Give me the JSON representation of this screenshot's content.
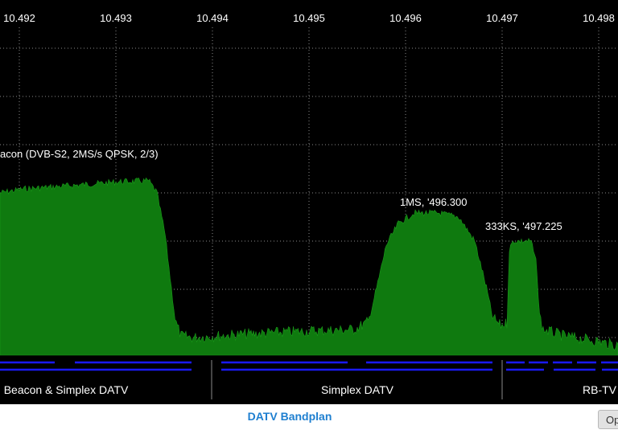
{
  "spectrum": {
    "frequency_ticks": [
      "10.492",
      "10.493",
      "10.494",
      "10.495",
      "10.496",
      "10.497",
      "10.498"
    ],
    "colors": {
      "background": "#000000",
      "signal": "#0f7a0f",
      "signal_edge": "#1a9a1a",
      "grid": "#8a8a8a",
      "band_line": "#1a1aff"
    },
    "signals": [
      {
        "label": "acon (DVB-S2, 2MS/s QPSK, 2/3)"
      },
      {
        "label": "1MS, '496.300"
      },
      {
        "label": "333KS, '497.225"
      }
    ]
  },
  "bands": [
    {
      "label": "Beacon & Simplex DATV"
    },
    {
      "label": "Simplex DATV"
    },
    {
      "label": "RB-TV"
    }
  ],
  "footer": {
    "bandplan_link": "DATV Bandplan",
    "options_button": "Op"
  }
}
